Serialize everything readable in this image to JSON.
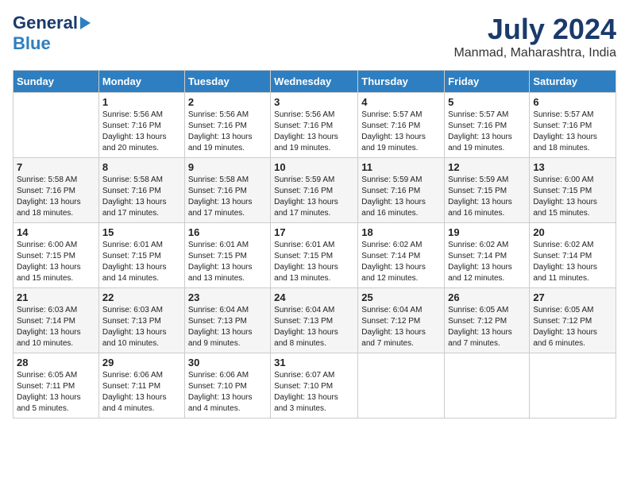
{
  "header": {
    "logo_general": "General",
    "logo_blue": "Blue",
    "month_year": "July 2024",
    "location": "Manmad, Maharashtra, India"
  },
  "days_of_week": [
    "Sunday",
    "Monday",
    "Tuesday",
    "Wednesday",
    "Thursday",
    "Friday",
    "Saturday"
  ],
  "weeks": [
    [
      {
        "day": "",
        "info": ""
      },
      {
        "day": "1",
        "info": "Sunrise: 5:56 AM\nSunset: 7:16 PM\nDaylight: 13 hours\nand 20 minutes."
      },
      {
        "day": "2",
        "info": "Sunrise: 5:56 AM\nSunset: 7:16 PM\nDaylight: 13 hours\nand 19 minutes."
      },
      {
        "day": "3",
        "info": "Sunrise: 5:56 AM\nSunset: 7:16 PM\nDaylight: 13 hours\nand 19 minutes."
      },
      {
        "day": "4",
        "info": "Sunrise: 5:57 AM\nSunset: 7:16 PM\nDaylight: 13 hours\nand 19 minutes."
      },
      {
        "day": "5",
        "info": "Sunrise: 5:57 AM\nSunset: 7:16 PM\nDaylight: 13 hours\nand 19 minutes."
      },
      {
        "day": "6",
        "info": "Sunrise: 5:57 AM\nSunset: 7:16 PM\nDaylight: 13 hours\nand 18 minutes."
      }
    ],
    [
      {
        "day": "7",
        "info": "Sunrise: 5:58 AM\nSunset: 7:16 PM\nDaylight: 13 hours\nand 18 minutes."
      },
      {
        "day": "8",
        "info": "Sunrise: 5:58 AM\nSunset: 7:16 PM\nDaylight: 13 hours\nand 17 minutes."
      },
      {
        "day": "9",
        "info": "Sunrise: 5:58 AM\nSunset: 7:16 PM\nDaylight: 13 hours\nand 17 minutes."
      },
      {
        "day": "10",
        "info": "Sunrise: 5:59 AM\nSunset: 7:16 PM\nDaylight: 13 hours\nand 17 minutes."
      },
      {
        "day": "11",
        "info": "Sunrise: 5:59 AM\nSunset: 7:16 PM\nDaylight: 13 hours\nand 16 minutes."
      },
      {
        "day": "12",
        "info": "Sunrise: 5:59 AM\nSunset: 7:15 PM\nDaylight: 13 hours\nand 16 minutes."
      },
      {
        "day": "13",
        "info": "Sunrise: 6:00 AM\nSunset: 7:15 PM\nDaylight: 13 hours\nand 15 minutes."
      }
    ],
    [
      {
        "day": "14",
        "info": "Sunrise: 6:00 AM\nSunset: 7:15 PM\nDaylight: 13 hours\nand 15 minutes."
      },
      {
        "day": "15",
        "info": "Sunrise: 6:01 AM\nSunset: 7:15 PM\nDaylight: 13 hours\nand 14 minutes."
      },
      {
        "day": "16",
        "info": "Sunrise: 6:01 AM\nSunset: 7:15 PM\nDaylight: 13 hours\nand 13 minutes."
      },
      {
        "day": "17",
        "info": "Sunrise: 6:01 AM\nSunset: 7:15 PM\nDaylight: 13 hours\nand 13 minutes."
      },
      {
        "day": "18",
        "info": "Sunrise: 6:02 AM\nSunset: 7:14 PM\nDaylight: 13 hours\nand 12 minutes."
      },
      {
        "day": "19",
        "info": "Sunrise: 6:02 AM\nSunset: 7:14 PM\nDaylight: 13 hours\nand 12 minutes."
      },
      {
        "day": "20",
        "info": "Sunrise: 6:02 AM\nSunset: 7:14 PM\nDaylight: 13 hours\nand 11 minutes."
      }
    ],
    [
      {
        "day": "21",
        "info": "Sunrise: 6:03 AM\nSunset: 7:14 PM\nDaylight: 13 hours\nand 10 minutes."
      },
      {
        "day": "22",
        "info": "Sunrise: 6:03 AM\nSunset: 7:13 PM\nDaylight: 13 hours\nand 10 minutes."
      },
      {
        "day": "23",
        "info": "Sunrise: 6:04 AM\nSunset: 7:13 PM\nDaylight: 13 hours\nand 9 minutes."
      },
      {
        "day": "24",
        "info": "Sunrise: 6:04 AM\nSunset: 7:13 PM\nDaylight: 13 hours\nand 8 minutes."
      },
      {
        "day": "25",
        "info": "Sunrise: 6:04 AM\nSunset: 7:12 PM\nDaylight: 13 hours\nand 7 minutes."
      },
      {
        "day": "26",
        "info": "Sunrise: 6:05 AM\nSunset: 7:12 PM\nDaylight: 13 hours\nand 7 minutes."
      },
      {
        "day": "27",
        "info": "Sunrise: 6:05 AM\nSunset: 7:12 PM\nDaylight: 13 hours\nand 6 minutes."
      }
    ],
    [
      {
        "day": "28",
        "info": "Sunrise: 6:05 AM\nSunset: 7:11 PM\nDaylight: 13 hours\nand 5 minutes."
      },
      {
        "day": "29",
        "info": "Sunrise: 6:06 AM\nSunset: 7:11 PM\nDaylight: 13 hours\nand 4 minutes."
      },
      {
        "day": "30",
        "info": "Sunrise: 6:06 AM\nSunset: 7:10 PM\nDaylight: 13 hours\nand 4 minutes."
      },
      {
        "day": "31",
        "info": "Sunrise: 6:07 AM\nSunset: 7:10 PM\nDaylight: 13 hours\nand 3 minutes."
      },
      {
        "day": "",
        "info": ""
      },
      {
        "day": "",
        "info": ""
      },
      {
        "day": "",
        "info": ""
      }
    ]
  ]
}
